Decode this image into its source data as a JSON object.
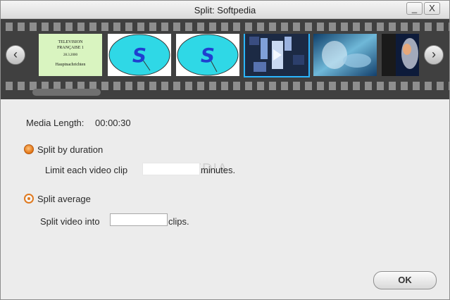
{
  "window": {
    "title": "Split: Softpedia",
    "minimize_label": "_",
    "close_label": "X"
  },
  "filmstrip": {
    "prev_label": "‹",
    "next_label": "›",
    "thumbnails": [
      {
        "lines": [
          "TELEVISION",
          "FRANÇAISE 1",
          "28.3.2000",
          "Hauptnachrichten"
        ]
      },
      {
        "letter": "S"
      },
      {
        "letter": "S"
      },
      {
        "selected": true
      },
      {},
      {}
    ]
  },
  "media_length": {
    "label": "Media Length:",
    "value": "00:00:30"
  },
  "split_by_duration": {
    "label": "Split by duration",
    "checked": true,
    "limit_prefix": "Limit each video clip",
    "limit_value": "",
    "limit_suffix": "minutes."
  },
  "split_average": {
    "label": "Split average",
    "checked": false,
    "clips_prefix": "Split video into",
    "clips_value": "",
    "clips_suffix": "clips."
  },
  "watermark": "SOFTPEDIA",
  "ok_label": "OK",
  "colors": {
    "accent_radio": "#e07212",
    "selection": "#2ab6ff",
    "filmstrip": "#404040"
  }
}
